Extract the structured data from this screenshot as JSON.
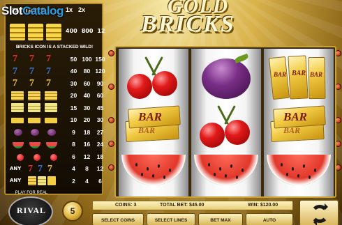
{
  "watermark": {
    "part1": "Slot",
    "part2": "Catalog"
  },
  "paytable": {
    "title": "PAY TABLE",
    "col1": "1x",
    "col2": "2x",
    "gold_vals": [
      "400",
      "800",
      "12"
    ],
    "wild_note": "BRICKS ICON IS A STACKED WILD!",
    "rows": [
      {
        "symbol": "red-seven",
        "vals": [
          "50",
          "100",
          "150"
        ]
      },
      {
        "symbol": "blue-seven",
        "vals": [
          "40",
          "80",
          "120"
        ]
      },
      {
        "symbol": "gold-seven",
        "vals": [
          "30",
          "60",
          "90"
        ]
      },
      {
        "symbol": "triple-bar",
        "vals": [
          "20",
          "40",
          "60"
        ]
      },
      {
        "symbol": "double-bar",
        "vals": [
          "15",
          "30",
          "45"
        ]
      },
      {
        "symbol": "single-bar",
        "vals": [
          "10",
          "20",
          "30"
        ]
      },
      {
        "symbol": "plum",
        "vals": [
          "9",
          "18",
          "27"
        ]
      },
      {
        "symbol": "watermelon",
        "vals": [
          "8",
          "16",
          "24"
        ]
      },
      {
        "symbol": "cherry-three",
        "vals": [
          "6",
          "12",
          "18"
        ]
      },
      {
        "symbol": "any-seven",
        "any": "ANY",
        "vals": [
          "4",
          "8",
          "12"
        ]
      },
      {
        "symbol": "any-bar",
        "any": "ANY",
        "vals": [
          "2",
          "4",
          "6"
        ]
      }
    ]
  },
  "logo": {
    "line1": "GOLD",
    "line2": "BRICKS"
  },
  "reels": [
    [
      "cherries",
      "bar-bricks",
      "watermelon"
    ],
    [
      "plum",
      "cherries",
      "watermelon"
    ],
    [
      "bar-bricks",
      "bar-bricks",
      "watermelon"
    ]
  ],
  "bar_label": "BAR",
  "brand": {
    "play_real": "PLAY FOR REAL",
    "name": "RIVAL"
  },
  "coin_value": "5",
  "status": {
    "coins": "COINS: 3",
    "total_bet": "TOTAL BET: $45.00",
    "win": "WIN: $120.00"
  },
  "buttons": {
    "select_coins": "SELECT COINS",
    "select_lines": "SELECT LINES",
    "bet_max": "BET MAX",
    "auto": "AUTO"
  },
  "colors": {
    "accent_gold": "#c9a13a",
    "paytable_bg": "#120c03"
  }
}
